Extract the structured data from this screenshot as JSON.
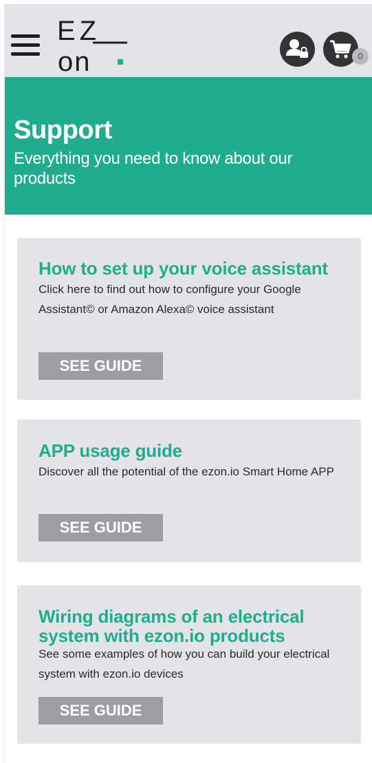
{
  "header": {
    "logo_top": "EZ",
    "logo_bottom": "on",
    "cart_count": "0"
  },
  "hero": {
    "title": "Support",
    "subtitle": "Everything you need to know about our products",
    "color": "#1fad8d"
  },
  "cards": [
    {
      "title": "How to set up your voice assistant",
      "description": "Click here to find out how to configure your Google Assistant© or Amazon Alexa© voice assistant",
      "button_label": "SEE GUIDE"
    },
    {
      "title": "APP usage guide",
      "description": "Discover all the potential of the ezon.io Smart Home APP",
      "button_label": "SEE GUIDE"
    },
    {
      "title": "Wiring diagrams of an electrical system with ezon.io products",
      "description": "See some examples of how you can build your electrical system with ezon.io devices",
      "button_label": "SEE GUIDE"
    }
  ],
  "icons": {
    "menu": "hamburger-menu-icon",
    "user": "user-lock-icon",
    "cart": "shopping-cart-icon"
  }
}
